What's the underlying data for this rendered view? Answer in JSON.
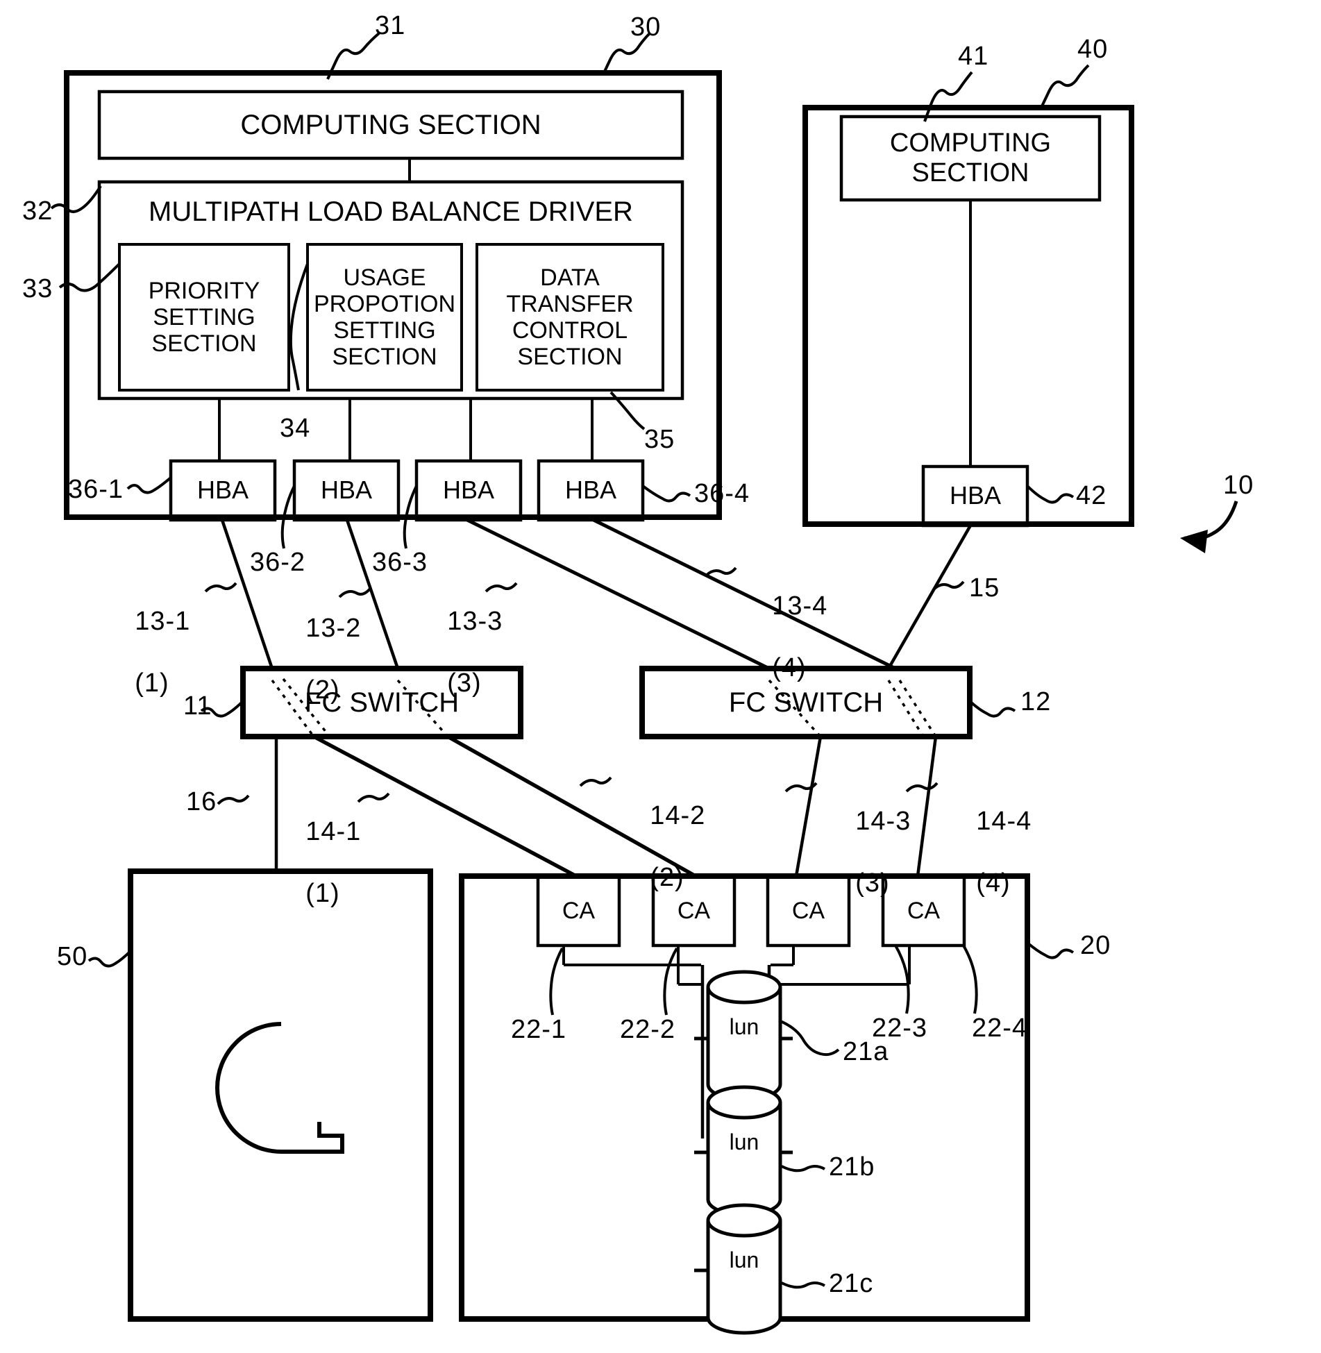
{
  "figure": {
    "type": "patent-block-diagram",
    "overall_ref": "10"
  },
  "host_server": {
    "ref": "30",
    "computing_section": {
      "label": "COMPUTING SECTION",
      "ref": "31"
    },
    "driver": {
      "label": "MULTIPATH LOAD BALANCE DRIVER",
      "ref": "32"
    },
    "modules": [
      {
        "label": "PRIORITY\nSETTING\nSECTION",
        "ref": "33"
      },
      {
        "label": "USAGE\nPROPOTION\nSETTING\nSECTION",
        "ref": "34"
      },
      {
        "label": "DATA\nTRANSFER\nCONTROL\nSECTION",
        "ref": "35"
      }
    ],
    "hbas": [
      {
        "label": "HBA",
        "ref": "36-1"
      },
      {
        "label": "HBA",
        "ref": "36-2"
      },
      {
        "label": "HBA",
        "ref": "36-3"
      },
      {
        "label": "HBA",
        "ref": "36-4"
      }
    ]
  },
  "second_server": {
    "ref": "40",
    "computing_section": {
      "label": "COMPUTING\nSECTION",
      "ref": "41"
    },
    "hba": {
      "label": "HBA",
      "ref": "42"
    }
  },
  "switches": [
    {
      "label": "FC SWITCH",
      "ref": "11"
    },
    {
      "label": "FC SWITCH",
      "ref": "12"
    }
  ],
  "upper_paths": [
    {
      "ref": "13-1",
      "path_no": "(1)"
    },
    {
      "ref": "13-2",
      "path_no": "(2)"
    },
    {
      "ref": "13-3",
      "path_no": "(3)"
    },
    {
      "ref": "13-4",
      "path_no": "(4)"
    }
  ],
  "lower_paths": [
    {
      "ref": "14-1",
      "path_no": "(1)"
    },
    {
      "ref": "14-2",
      "path_no": "(2)"
    },
    {
      "ref": "14-3",
      "path_no": "(3)"
    },
    {
      "ref": "14-4",
      "path_no": "(4)"
    }
  ],
  "second_server_link": {
    "ref": "15"
  },
  "other_device_link": {
    "ref": "16"
  },
  "storage": {
    "ref": "20",
    "channel_adapters": [
      {
        "label": "CA",
        "ref": "22-1"
      },
      {
        "label": "CA",
        "ref": "22-2"
      },
      {
        "label": "CA",
        "ref": "22-3"
      },
      {
        "label": "CA",
        "ref": "22-4"
      }
    ],
    "luns": [
      {
        "label": "lun",
        "ref": "21a"
      },
      {
        "label": "lun",
        "ref": "21b"
      },
      {
        "label": "lun",
        "ref": "21c"
      }
    ]
  },
  "other_device": {
    "ref": "50",
    "glyph": "q-shape-icon"
  },
  "colors": {
    "stroke": "#000000",
    "background": "#ffffff"
  }
}
